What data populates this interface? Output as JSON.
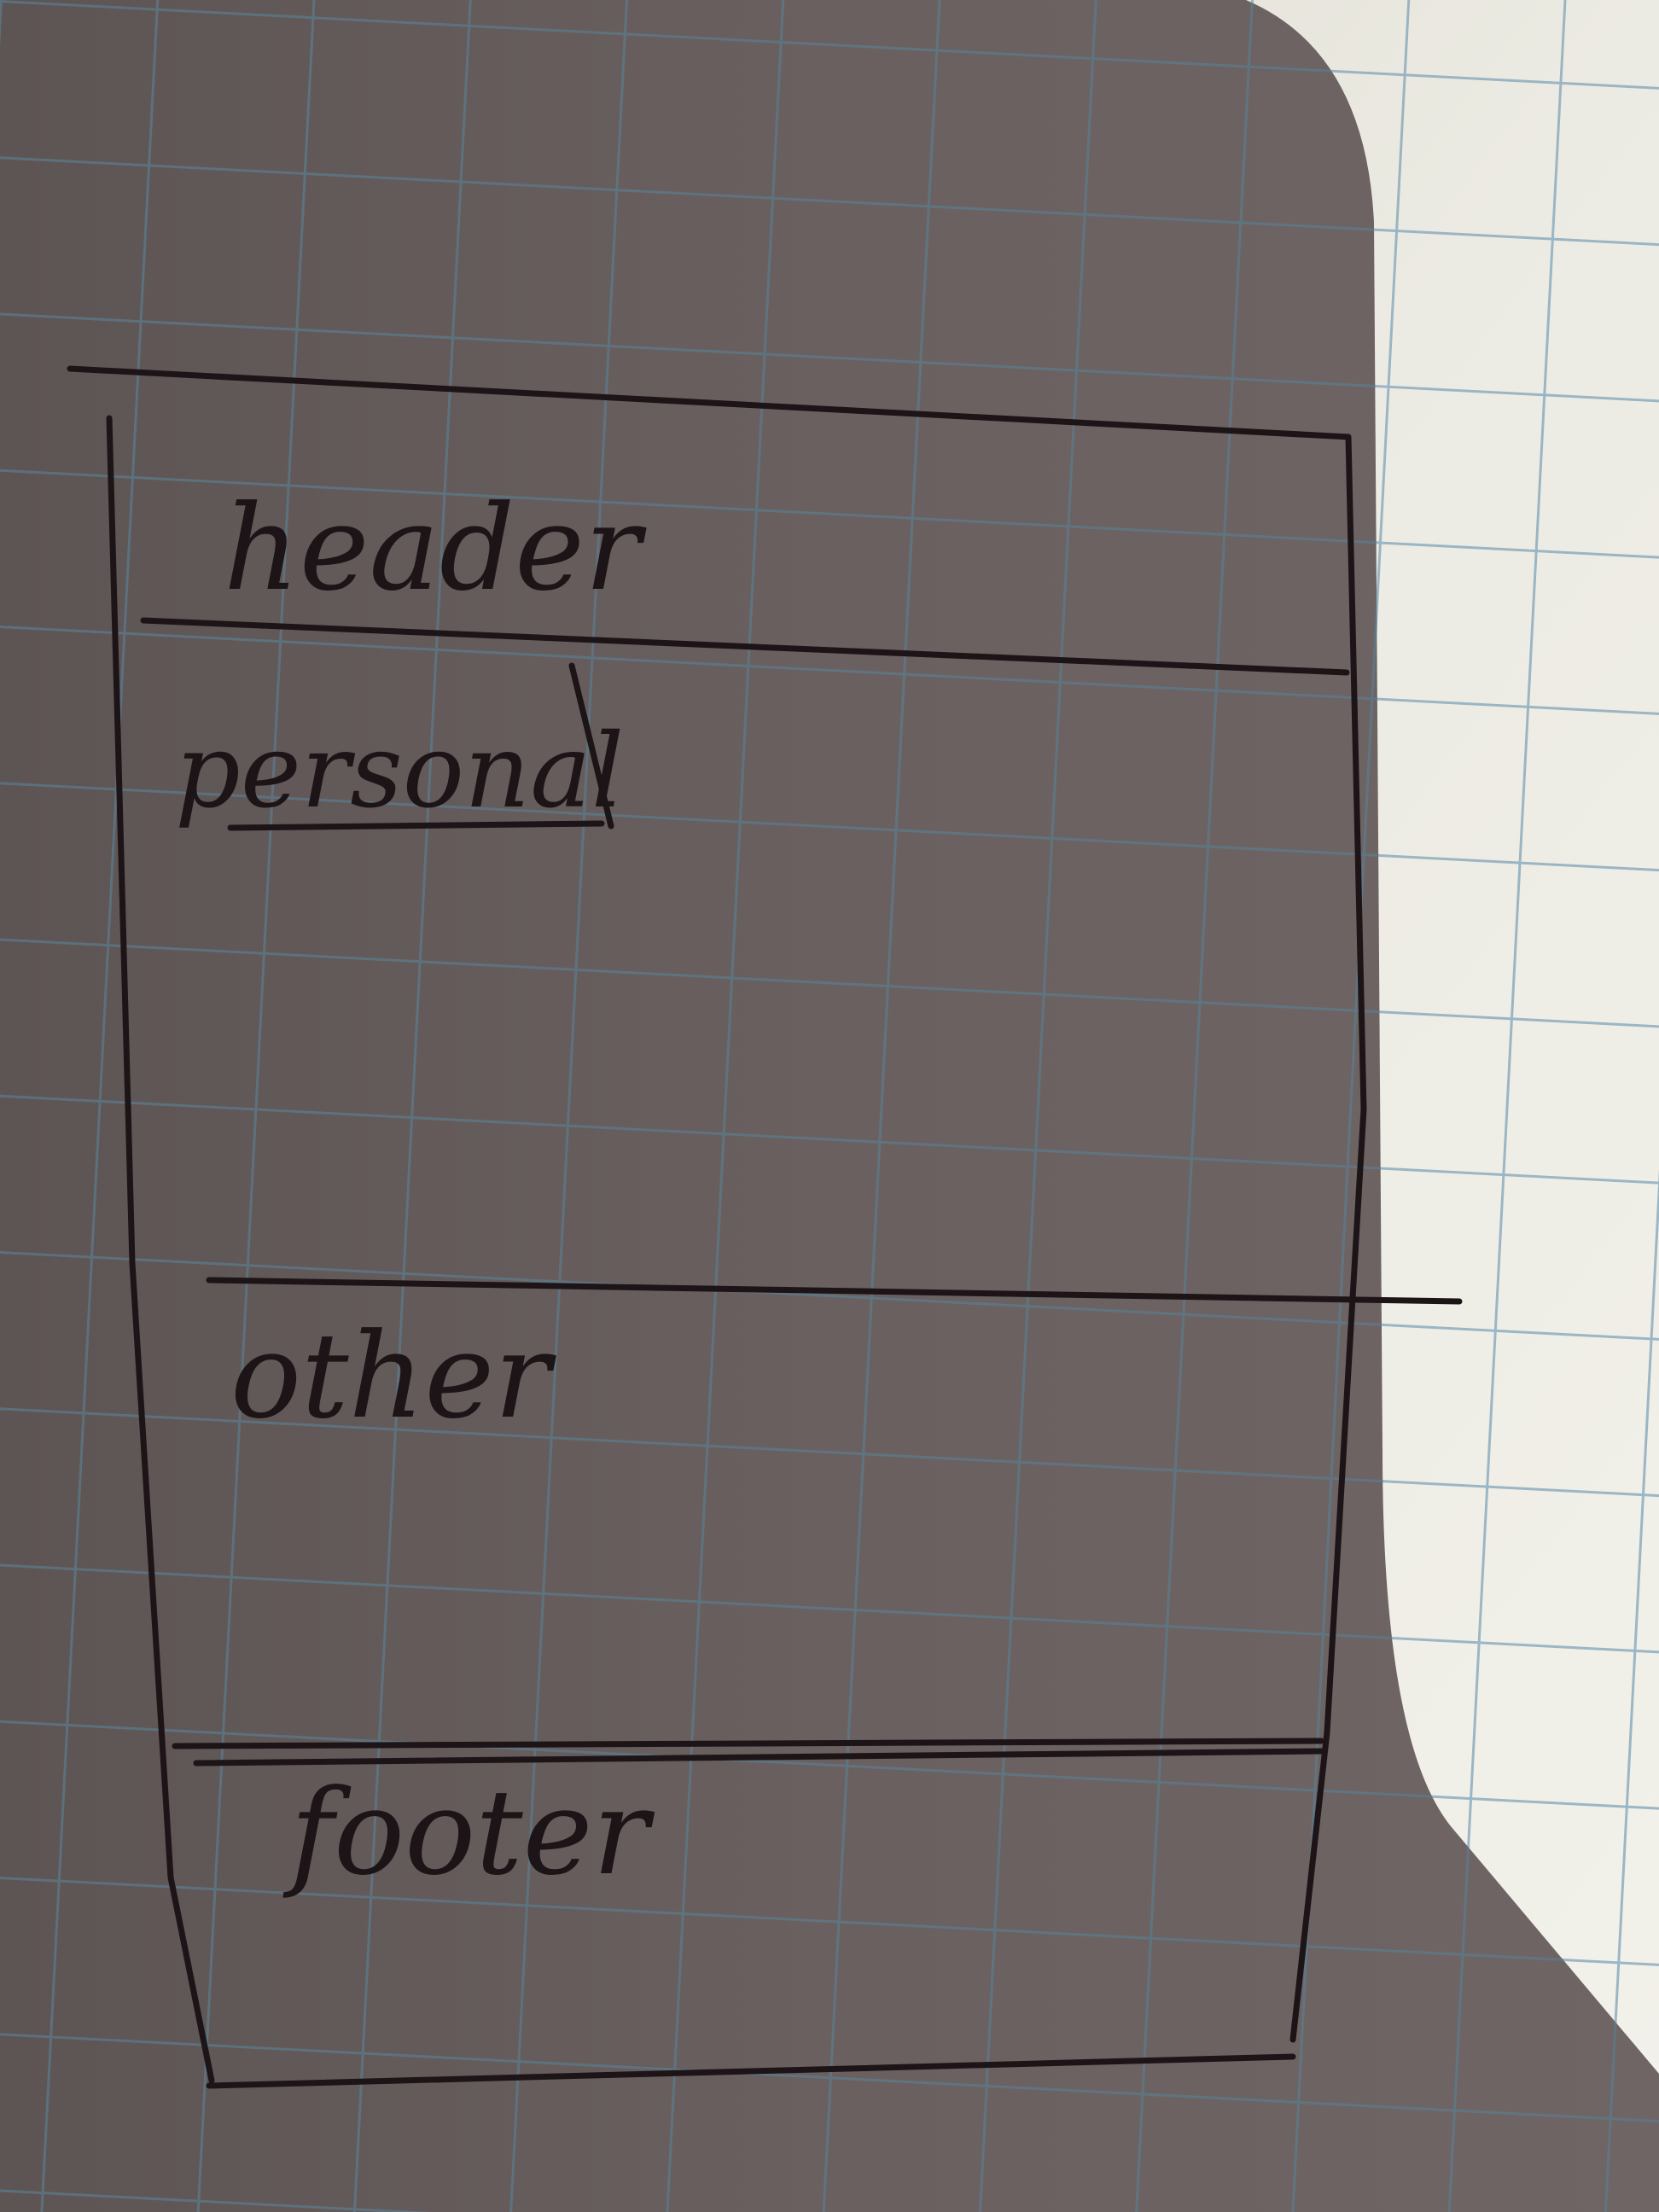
{
  "sketch": {
    "header_label": "header",
    "personal_label": "personal",
    "other_label": "other",
    "footer_label": "footer"
  },
  "colors": {
    "shadow_paper": "#6c6161",
    "lit_paper": "#e9e6dd",
    "grid_line": "#7fa3b8",
    "ink": "#1c1416"
  }
}
